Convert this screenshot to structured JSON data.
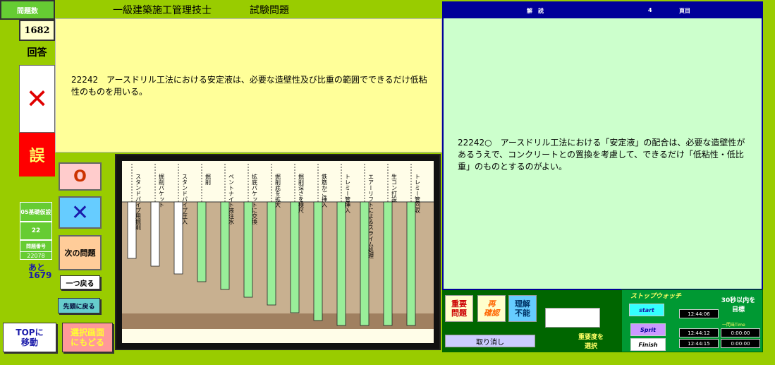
{
  "sidebar": {
    "count_title": "問題数",
    "count_value": "1682",
    "answer_label": "回答",
    "answer_mark": "✕",
    "judgement": "誤",
    "category": "05基礎仮設",
    "cat_count": "22",
    "current_label": "問題番号",
    "current_no": "22078",
    "remain_label": "あと",
    "remain_value": "1679"
  },
  "header": {
    "title": "一級建築施工管理技士",
    "subtitle": "試験問題"
  },
  "question": {
    "text": "22242　アースドリル工法における安定液は、必要な造壁性及び比重の範囲でできるだけ低粘性のものを用いる。"
  },
  "buttons": {
    "o": "O",
    "x": "✕",
    "next": "次の問題",
    "back_one": "一つ戻る",
    "to_first": "先頭に戻る",
    "top": [
      "TOPに",
      "移動"
    ],
    "select": [
      "選択画面",
      "にもどる"
    ]
  },
  "diagram": {
    "labels": [
      "スタンドパイプ用掘削",
      "掘削バケット",
      "スタンドパイプ圧入",
      "掘削",
      "ベントナイト液注水",
      "拡底バケットに交換",
      "掘削底を拡大",
      "掘削深さを検尺",
      "鉄筋かご挿入",
      "トレミー管挿入",
      "エアーリフトによるスライム処理",
      "生コン打設",
      "トレミー管回収"
    ]
  },
  "explanation": {
    "header_label": "解　説",
    "page_number": "4",
    "page_suffix": "頁目",
    "text": "22242○　アースドリル工法における「安定液」の配合は、必要な造壁性があるうえで、コンクリートとの置換を考慮して、できるだけ「低粘性・低比重」のものとするのがよい。"
  },
  "importance": {
    "important": [
      "重要",
      "問題"
    ],
    "reconfirm": [
      "再",
      "確認"
    ],
    "no_understand": [
      "理解",
      "不能"
    ],
    "cancel": "取り消し",
    "select_note": [
      "重要度を",
      "選択"
    ]
  },
  "stopwatch": {
    "title": "ストップウォッチ",
    "goal": [
      "30秒以内を",
      "目標"
    ],
    "start": "start",
    "split": "Sprit",
    "finish": "Finish",
    "start_time": "12:44:06",
    "per_label": "一問当Time",
    "split_time": "12:44:12",
    "split_elapsed": "0:00:00",
    "finish_time": "12:44:15",
    "finish_elapsed": "0:00:00"
  },
  "colors": {
    "background": "#99cc00",
    "question_bg": "#ffff99",
    "explanation_bg": "#ccffcc",
    "header_blue": "#000099",
    "wrong_red": "#ff0000",
    "dark_green": "#006600"
  }
}
